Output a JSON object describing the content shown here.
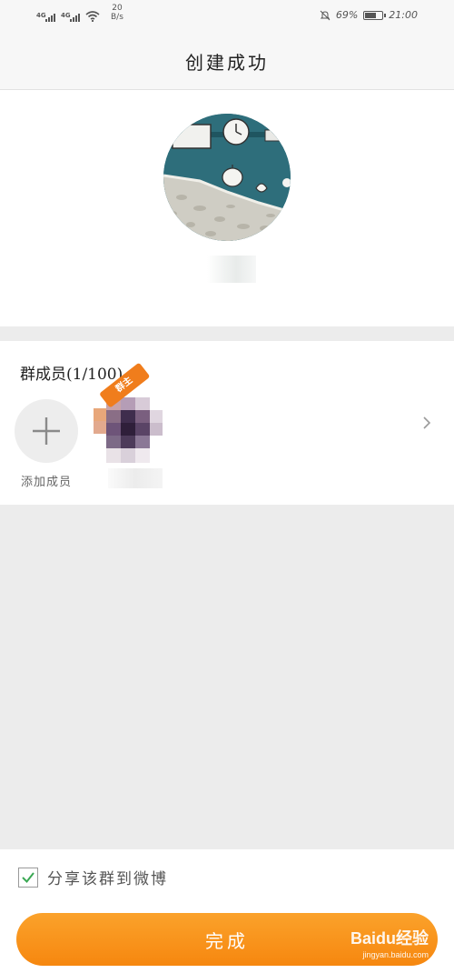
{
  "status_bar": {
    "network_1": "4G",
    "network_2": "4G",
    "speed_value": "20",
    "speed_unit": "B/s",
    "battery_percent": "69%",
    "battery_level": 0.69,
    "time": "21:00"
  },
  "header": {
    "title": "创建成功"
  },
  "group": {
    "avatar_icon": "group-photo-avatar"
  },
  "members": {
    "title": "群成员(1/100)",
    "add_label": "添加成员",
    "owner_badge": "群主",
    "chevron_icon": "chevron-right-icon"
  },
  "share": {
    "label": "分享该群到微博",
    "checked": true,
    "check_color": "#3aa853"
  },
  "done_button": {
    "label": "完成",
    "color": "#f7901a"
  },
  "watermark": {
    "brand": "Baidu经验",
    "url": "jingyan.baidu.com"
  }
}
